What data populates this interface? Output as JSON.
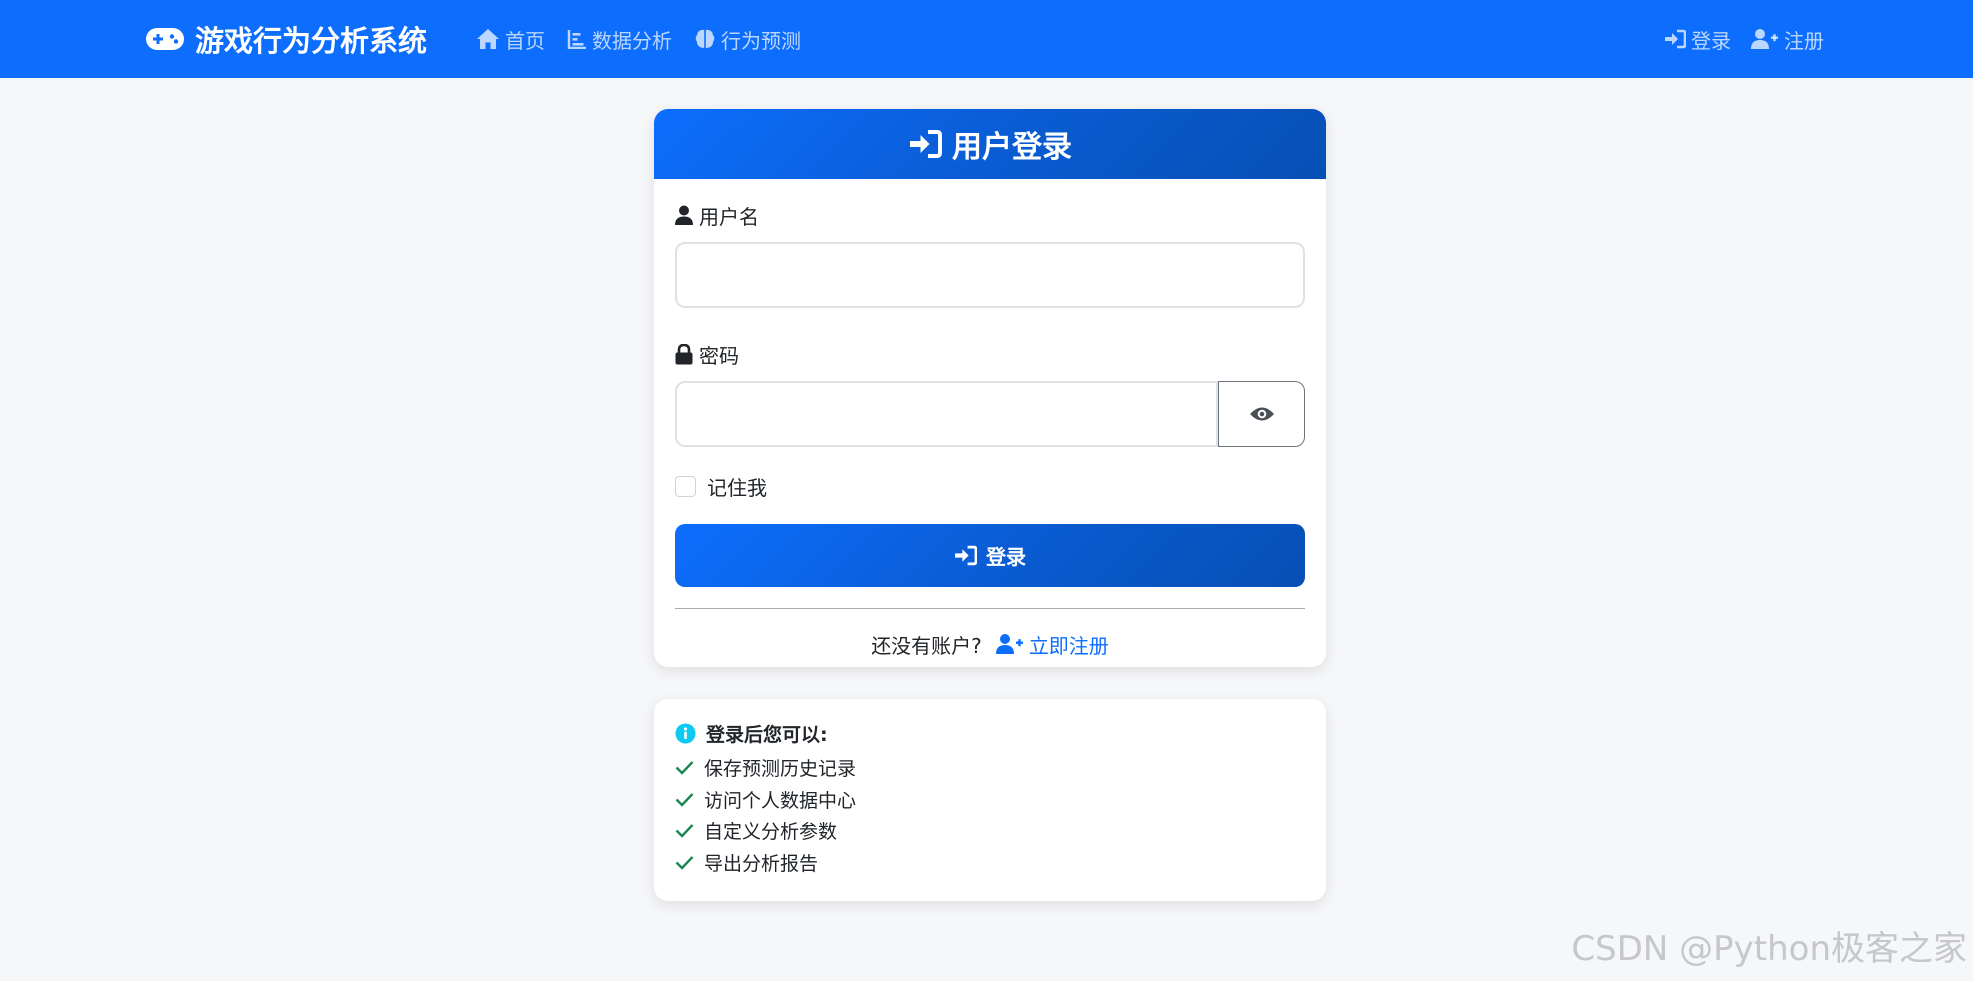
{
  "navbar": {
    "brand": "游戏行为分析系统",
    "brand_icon": "gamepad-icon",
    "links": [
      {
        "label": "首页",
        "icon": "home-icon"
      },
      {
        "label": "数据分析",
        "icon": "chart-icon"
      },
      {
        "label": "行为预测",
        "icon": "brain-icon"
      }
    ],
    "auth_links": [
      {
        "label": "登录",
        "icon": "sign-in-icon"
      },
      {
        "label": "注册",
        "icon": "user-plus-icon"
      }
    ]
  },
  "login_card": {
    "title": "用户登录",
    "username_label": "用户名",
    "username_value": "",
    "password_label": "密码",
    "password_value": "",
    "remember_label": "记住我",
    "remember_checked": false,
    "submit_label": "登录",
    "register_prompt": "还没有账户?",
    "register_link": "立即注册"
  },
  "info_card": {
    "title": "登录后您可以:",
    "items": [
      "保存预测历史记录",
      "访问个人数据中心",
      "自定义分析参数",
      "导出分析报告"
    ]
  },
  "watermark": "CSDN @Python极客之家",
  "colors": {
    "primary": "#0d6efd",
    "primary_dark": "#0650b4",
    "success": "#198754",
    "info": "#0dcaf0",
    "background": "#f6f7f9"
  }
}
